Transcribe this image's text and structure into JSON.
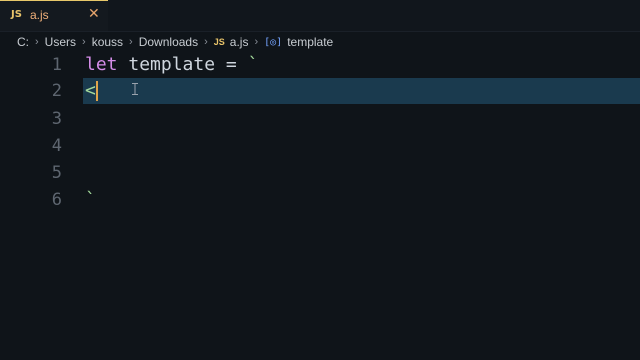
{
  "tab": {
    "badge": "JS",
    "filename": "a.js",
    "close": "✕"
  },
  "breadcrumb": {
    "segments": [
      "C:",
      "Users",
      "kouss",
      "Downloads"
    ],
    "file_badge": "JS",
    "file": "a.js",
    "symbol_icon": "[◎]",
    "symbol": "template",
    "separator": "›"
  },
  "editor": {
    "lines": [
      {
        "number": "1",
        "kw": "let",
        "name": "template",
        "op": "=",
        "str": "`"
      },
      {
        "number": "2",
        "text": "<"
      },
      {
        "number": "3",
        "text": ""
      },
      {
        "number": "4",
        "text": ""
      },
      {
        "number": "5",
        "text": ""
      },
      {
        "number": "6",
        "text": "`"
      }
    ]
  },
  "colors": {
    "background": "#0f1419",
    "active_line": "#1a3a4e",
    "keyword": "#d48de8",
    "string": "#a3d99b",
    "tab_accent": "#f0b07a"
  }
}
